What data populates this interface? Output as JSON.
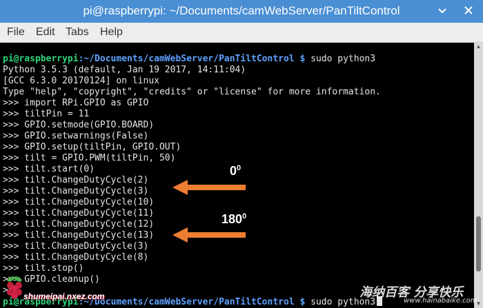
{
  "window": {
    "title": "pi@raspberrypi: ~/Documents/camWebServer/PanTiltControl",
    "minimize_icon": "chevron-down-icon",
    "close_icon": "close-icon"
  },
  "menu": [
    "File",
    "Edit",
    "Tabs",
    "Help"
  ],
  "terminal": {
    "prompt_user": "pi@raspberrypi",
    "prompt_path": ":~/Documents/camWebServer/PanTiltControl $",
    "first_command": " sudo python3",
    "lines": [
      "Python 3.5.3 (default, Jan 19 2017, 14:11:04)",
      "[GCC 6.3.0 20170124] on linux",
      "Type \"help\", \"copyright\", \"credits\" or \"license\" for more information.",
      ">>> import RPi.GPIO as GPIO",
      ">>> tiltPin = 11",
      ">>> GPIO.setmode(GPIO.BOARD)",
      ">>> GPIO.setwarnings(False)",
      ">>> GPIO.setup(tiltPin, GPIO.OUT)",
      ">>> tilt = GPIO.PWM(tiltPin, 50)",
      ">>> tilt.start(0)",
      ">>> tilt.ChangeDutyCycle(2)",
      ">>> tilt.ChangeDutyCycle(3)",
      ">>> tilt.ChangeDutyCycle(10)",
      ">>> tilt.ChangeDutyCycle(11)",
      ">>> tilt.ChangeDutyCycle(12)",
      ">>> tilt.ChangeDutyCycle(13)",
      ">>> tilt.ChangeDutyCycle(3)",
      ">>> tilt.ChangeDutyCycle(8)",
      ">>> tilt.stop()",
      ">>> GPIO.cleanup()",
      ">>>"
    ],
    "last_command": " sudo python3"
  },
  "annotations": {
    "zero": {
      "value": "0",
      "unit": "0"
    },
    "one_eighty": {
      "value": "180",
      "unit": "0"
    },
    "arrow_color": "#ee7d32"
  },
  "watermarks": {
    "left_logo_icon": "raspberry-icon",
    "left_text": "shumeipai.nxez.com",
    "right_cn": "海纳百客 分享快乐",
    "right_en": "www.hainabaike.com"
  },
  "colors": {
    "titlebar": "#4a8fd4",
    "prompt_user": "#2ed67a",
    "prompt_path": "#5da2ff",
    "text": "#e6e6e6"
  }
}
